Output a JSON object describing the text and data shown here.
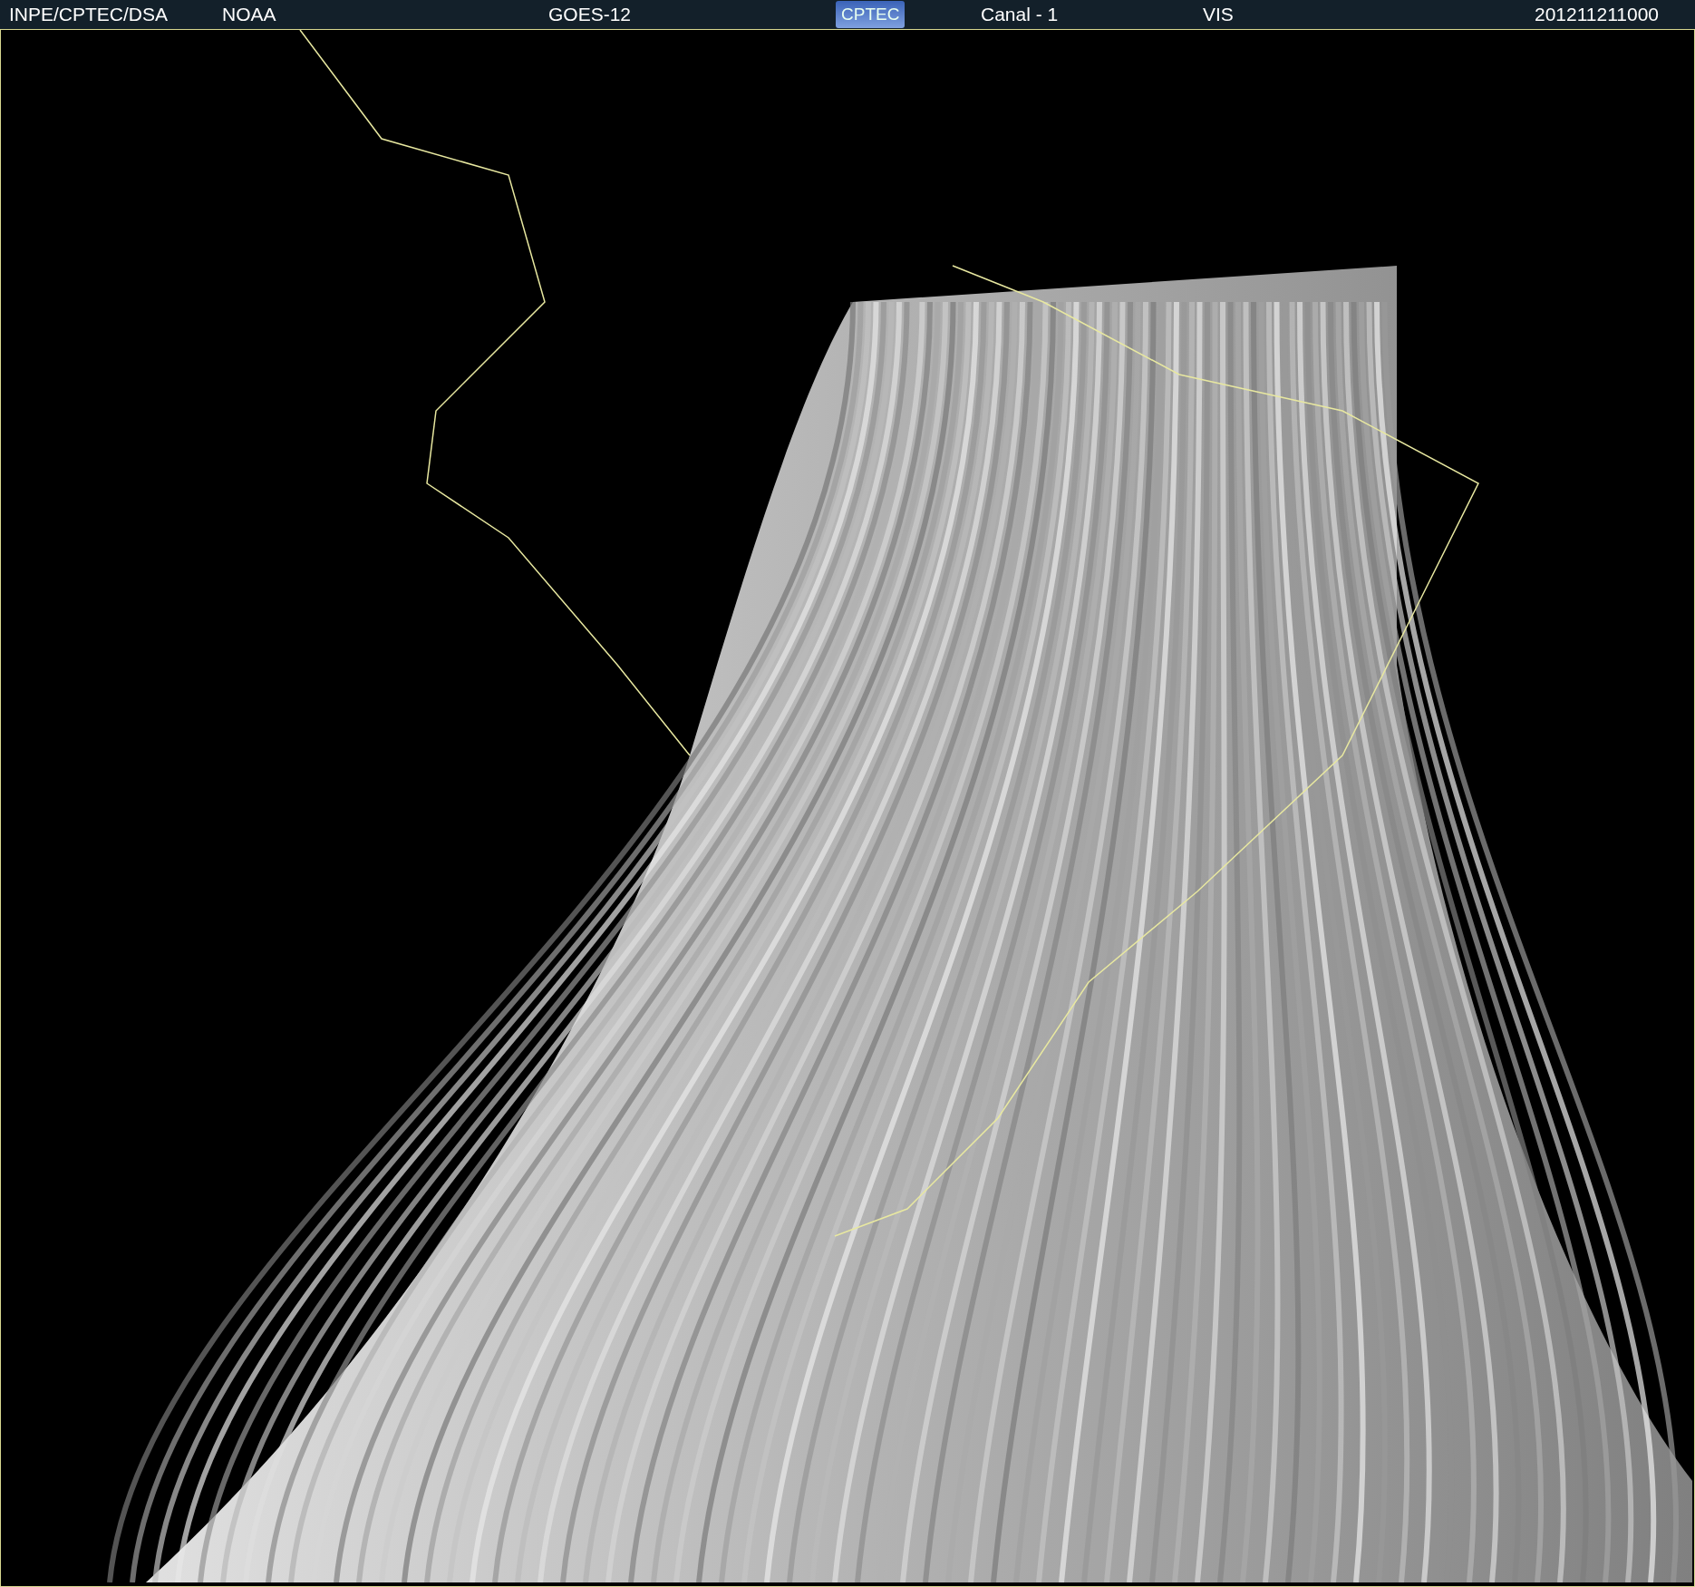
{
  "header": {
    "items": [
      "INPE/CPTEC/DSA",
      "NOAA",
      "GOES-12",
      "Canal - 1",
      "VIS",
      "201211211000"
    ],
    "logo": "CPTEC"
  }
}
